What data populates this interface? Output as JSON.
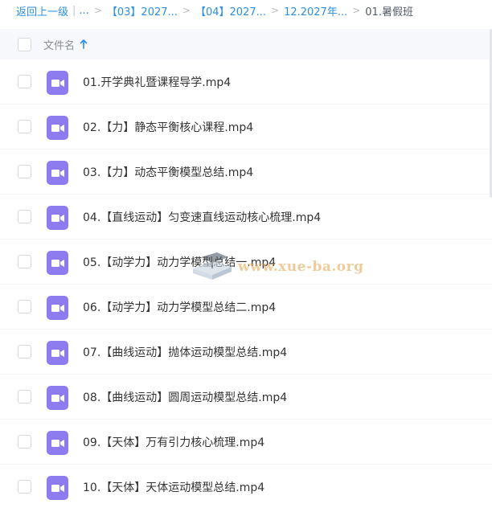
{
  "breadcrumb": {
    "back": "返回上一级",
    "ellipsis": "...",
    "crumb1": "【03】2027...",
    "crumb2": "【04】2027...",
    "crumb3": "12.2027年...",
    "current": "01.暑假班"
  },
  "header": {
    "column_name": "文件名"
  },
  "files": [
    "01.开学典礼暨课程导学.mp4",
    "02.【力】静态平衡核心课程.mp4",
    "03.【力】动态平衡模型总结.mp4",
    "04.【直线运动】匀变速直线运动核心梳理.mp4",
    "05.【动学力】动力学模型总结一.mp4",
    "06.【动学力】动力学模型总结二.mp4",
    "07.【曲线运动】抛体运动模型总结.mp4",
    "08.【曲线运动】圆周运动模型总结.mp4",
    "09.【天体】万有引力核心梳理.mp4",
    "10.【天体】天体运动模型总结.mp4"
  ],
  "watermark": "www.xue-ba.org",
  "colors": {
    "link": "#2a8ee6",
    "video_icon": "#8c7cf0"
  },
  "icons": {
    "file": "video-icon",
    "sort": "arrow-up-icon"
  }
}
